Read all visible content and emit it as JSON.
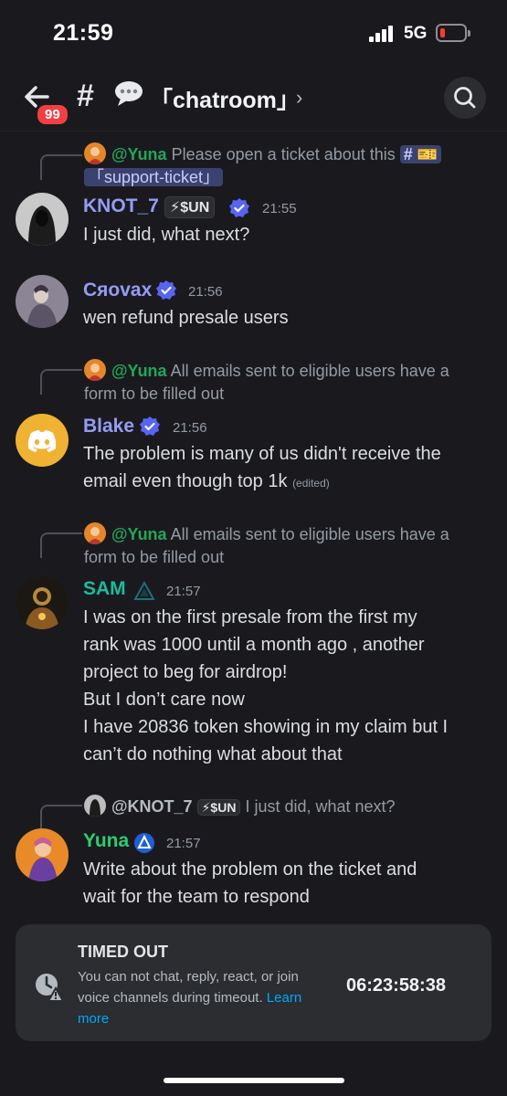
{
  "status_bar": {
    "time": "21:59",
    "network": "5G"
  },
  "header": {
    "unread_count": "99",
    "channel_name": "「chatroom」",
    "chevron": "›"
  },
  "messages": [
    {
      "reply_mention": "@Yuna",
      "reply_text_line1": "Please open a ticket about this",
      "reply_channel": "「support-ticket」",
      "username": "KNOT_7",
      "tag": "⚡$UN",
      "time": "21:55",
      "body": "I just did, what next?"
    },
    {
      "username": "Cяovax",
      "time": "21:56",
      "body": "wen refund presale users"
    },
    {
      "reply_mention": "@Yuna",
      "reply_text_line1": "All emails sent to eligible users have a",
      "reply_text_line2": "form to be filled out",
      "username": "Blake",
      "time": "21:56",
      "body_line1": "The problem is many of us didn't receive the",
      "body_line2": "email even though top 1k",
      "edited": "(edited)"
    },
    {
      "reply_mention": "@Yuna",
      "reply_text_line1": "All emails sent to eligible users have a",
      "reply_text_line2": "form to be filled out",
      "username": "SAM",
      "time": "21:57",
      "body_lines": [
        "I was on the first presale from the first my",
        "rank was 1000 until a month ago , another",
        "project to beg for airdrop!",
        "But I don’t care now",
        "I have 20836 token showing in my claim but I",
        "can’t do nothing what about that"
      ]
    },
    {
      "reply_mention": "@KNOT_7",
      "reply_tag": "⚡$UN",
      "reply_text_line1": "I just did, what next?",
      "username": "Yuna",
      "time": "21:57",
      "body_line1": "Write about the problem on the ticket and",
      "body_line2": "wait for the team to respond"
    }
  ],
  "timeout": {
    "title": "TIMED OUT",
    "description": "You can not chat, reply, react, or join voice channels during timeout.",
    "learn_more": "Learn more",
    "countdown": "06:23:58:38"
  },
  "colors": {
    "background": "#1a1a1e",
    "knot_name": "#949cf7",
    "cryovax_name": "#949cf7",
    "blake_name": "#949cf7",
    "sam_name": "#1abc9c",
    "yuna_name": "#2ecc71",
    "verified": "#5865f2",
    "link": "#00a8fc",
    "badge": "#f23f43"
  },
  "icons": [
    "back-arrow-icon",
    "hash-icon",
    "speech-bubble-icon",
    "chevron-right-icon",
    "search-icon",
    "verified-badge-icon",
    "clock-warning-icon",
    "discord-logo-icon"
  ]
}
